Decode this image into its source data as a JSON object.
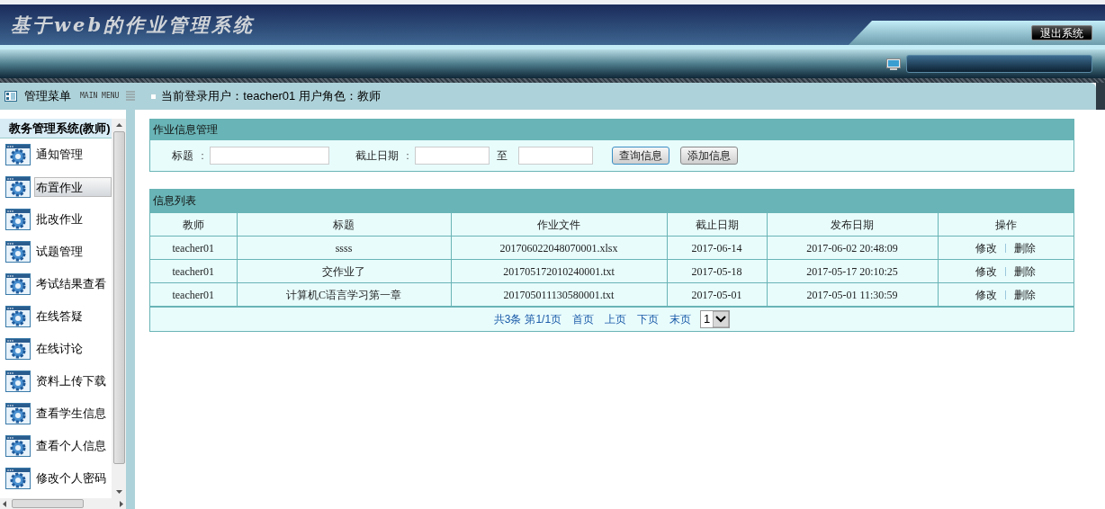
{
  "header": {
    "title": "基于web的作业管理系统",
    "logout_button": "退出系统"
  },
  "menu_bar": {
    "title": "管理菜单",
    "subtitle": "MAIN MENU",
    "user_label": "当前登录用户：",
    "user": "teacher01",
    "role_label": "用户角色：",
    "role": "教师"
  },
  "sidebar": {
    "title": "教务管理系统(教师)",
    "items": [
      {
        "label": "通知管理",
        "selected": false
      },
      {
        "label": "布置作业",
        "selected": true
      },
      {
        "label": "批改作业",
        "selected": false
      },
      {
        "label": "试题管理",
        "selected": false
      },
      {
        "label": "考试结果查看",
        "selected": false
      },
      {
        "label": "在线答疑",
        "selected": false
      },
      {
        "label": "在线讨论",
        "selected": false
      },
      {
        "label": "资料上传下载",
        "selected": false
      },
      {
        "label": "查看学生信息",
        "selected": false
      },
      {
        "label": "查看个人信息",
        "selected": false
      },
      {
        "label": "修改个人密码",
        "selected": false
      }
    ]
  },
  "search_panel": {
    "title": "作业信息管理",
    "title_label": "标题",
    "date_label": "截止日期",
    "separator": "：",
    "to_label": "至",
    "buttons": [
      "查询信息",
      "添加信息"
    ]
  },
  "list_panel": {
    "title": "信息列表",
    "columns": [
      "教师",
      "标题",
      "作业文件",
      "截止日期",
      "发布日期",
      "操作"
    ],
    "rows": [
      {
        "cells": [
          "teacher01",
          "ssss",
          "201706022048070001.xlsx",
          "2017-06-14",
          "2017-06-02 20:48:09"
        ],
        "actions": [
          "修改",
          "删除"
        ]
      },
      {
        "cells": [
          "teacher01",
          "交作业了",
          "201705172010240001.txt",
          "2017-05-18",
          "2017-05-17 20:10:25"
        ],
        "actions": [
          "修改",
          "删除"
        ]
      },
      {
        "cells": [
          "teacher01",
          "计算机C语言学习第一章",
          "201705011130580001.txt",
          "2017-05-01",
          "2017-05-01 11:30:59"
        ],
        "actions": [
          "修改",
          "删除"
        ]
      }
    ],
    "pagination": {
      "total": "共3条",
      "page": "第1/1页",
      "links": [
        "首页",
        "上页",
        "下页",
        "末页"
      ],
      "page_select": "1"
    }
  }
}
